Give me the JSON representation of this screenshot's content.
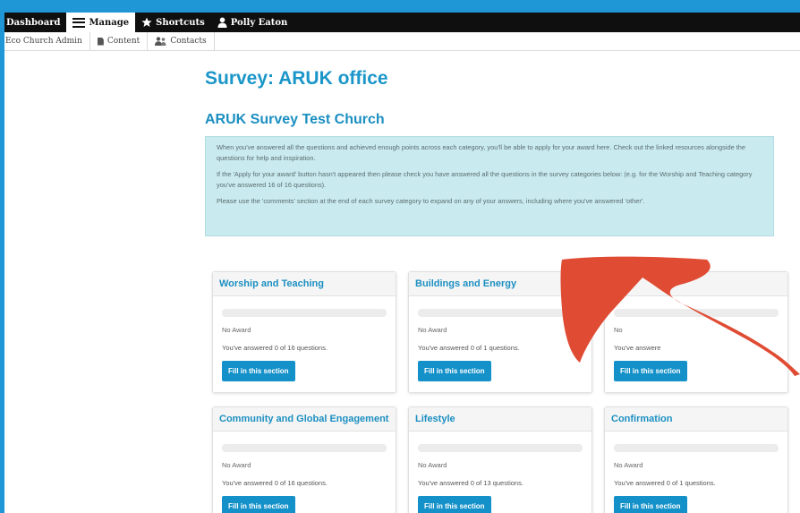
{
  "toolbar": {
    "dashboard": "Dashboard",
    "manage": "Manage",
    "shortcuts": "Shortcuts",
    "user": "Polly Eaton"
  },
  "tray": {
    "admin": "Eco Church Admin",
    "content": "Content",
    "contacts": "Contacts"
  },
  "page": {
    "title": "Survey: ARUK office",
    "subtitle": "ARUK Survey Test Church"
  },
  "info": {
    "p1": "When you've answered all the questions and achieved enough points across each category, you'll be able to apply for your award here. Check out the linked resources alongside the questions for help and inspiration.",
    "p2": "If the 'Apply for your award' button hasn't appeared then please check you have answered all the questions in the survey categories below: (e.g. for the Worship and Teaching category you've answered 16 of 16 questions).",
    "p3": "Please use the 'comments' section at the end of each survey category to expand on any of your answers, including where you've answered 'other'."
  },
  "cards": [
    {
      "title": "Worship and Teaching",
      "award": "No Award",
      "answered": "You've answered 0 of 16 questions.",
      "button": "Fill in this section",
      "progress": 0
    },
    {
      "title": "Buildings and Energy",
      "award": "No Award",
      "answered": "You've answered 0 of 1 questions.",
      "button": "Fill in this section",
      "progress": 0
    },
    {
      "title": "",
      "award": "No",
      "answered": "You've answere",
      "button": "Fill in this section",
      "progress": 0
    },
    {
      "title": "Community and Global Engagement",
      "award": "No Award",
      "answered": "You've answered 0 of 16 questions.",
      "button": "Fill in this section",
      "progress": 0
    },
    {
      "title": "Lifestyle",
      "award": "No Award",
      "answered": "You've answered 0 of 13 questions.",
      "button": "Fill in this section",
      "progress": 0
    },
    {
      "title": "Confirmation",
      "award": "No Award",
      "answered": "You've answered 0 of 1 questions.",
      "button": "Fill in this section",
      "progress": 0
    }
  ],
  "colors": {
    "accent": "#1b96c9",
    "button": "#1591c9",
    "info_bg": "#c9ebef",
    "annotation_arrow": "#e04b33",
    "border": "#1f97d6"
  },
  "icons": {
    "manage": "hamburger-icon",
    "shortcuts": "star-icon",
    "user": "person-icon",
    "content": "document-icon",
    "contacts": "people-icon"
  }
}
